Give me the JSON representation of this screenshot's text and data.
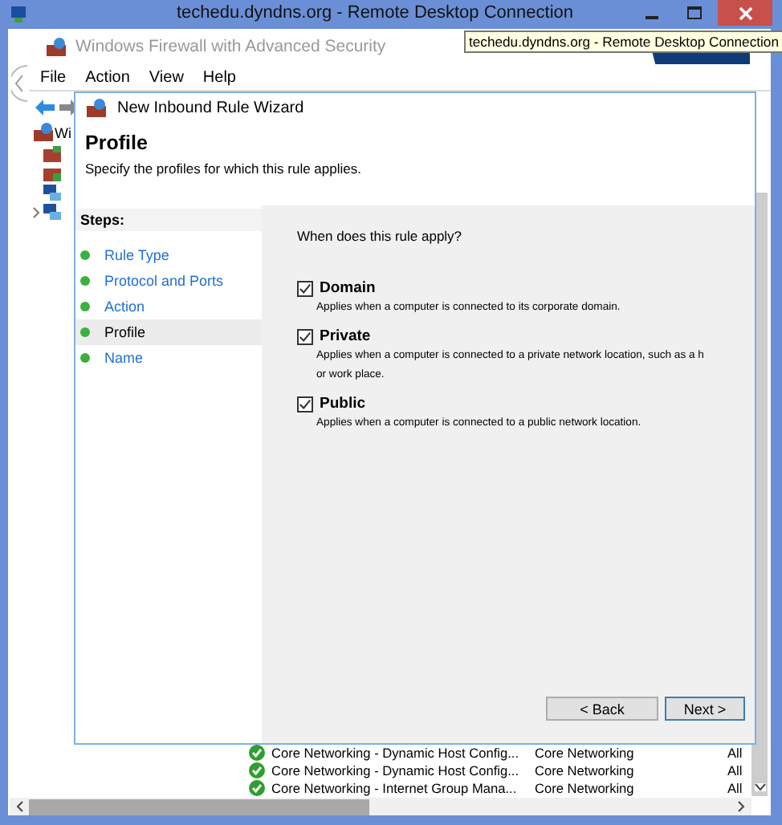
{
  "rdp_window": {
    "title": "techedu.dyndns.org - Remote Desktop Connection"
  },
  "tooltip": {
    "text": "techedu.dyndns.org - Remote Desktop Connection"
  },
  "app_window": {
    "title": "Windows Firewall with Advanced Security",
    "menu": [
      "File",
      "Action",
      "View",
      "Help"
    ]
  },
  "tree": {
    "root_label": "Wi"
  },
  "rule_list": {
    "rows": [
      {
        "name": "Core Networking - Dynamic Host Config...",
        "group": "Core Networking",
        "profile": "All"
      },
      {
        "name": "Core Networking - Dynamic Host Config...",
        "group": "Core Networking",
        "profile": "All"
      },
      {
        "name": "Core Networking - Internet Group Mana...",
        "group": "Core Networking",
        "profile": "All"
      }
    ]
  },
  "wizard": {
    "title": "New Inbound Rule Wizard",
    "heading": "Profile",
    "subtitle": "Specify the profiles for which this rule applies.",
    "steps_label": "Steps:",
    "steps": [
      {
        "label": "Rule Type",
        "selected": false
      },
      {
        "label": "Protocol and Ports",
        "selected": false
      },
      {
        "label": "Action",
        "selected": false
      },
      {
        "label": "Profile",
        "selected": true
      },
      {
        "label": "Name",
        "selected": false
      }
    ],
    "question": "When does this rule apply?",
    "options": [
      {
        "label": "Domain",
        "checked": true,
        "description_lines": [
          "Applies when a computer is connected to its corporate domain."
        ]
      },
      {
        "label": "Private",
        "checked": true,
        "description_lines": [
          "Applies when a computer is connected to a private network location, such as a h",
          "or work place."
        ]
      },
      {
        "label": "Public",
        "checked": true,
        "description_lines": [
          "Applies when a computer is connected to a public network location."
        ]
      }
    ],
    "buttons": [
      {
        "label": "< Back",
        "default": false
      },
      {
        "label": "Next >",
        "default": true
      }
    ]
  }
}
